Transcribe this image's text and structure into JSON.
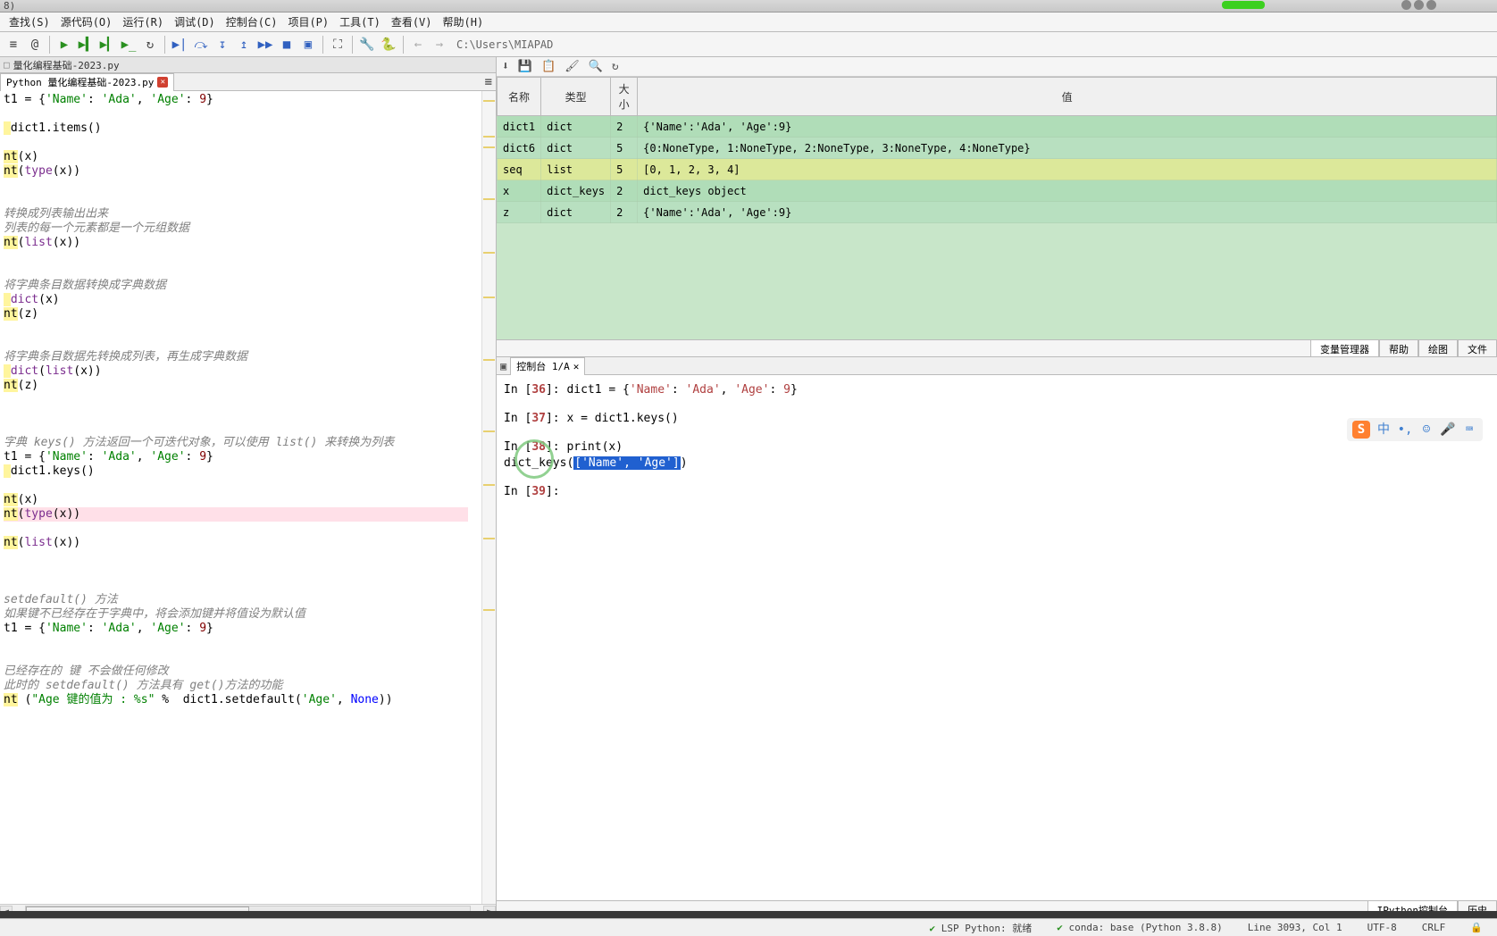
{
  "title_text": "8)",
  "menu": {
    "items": [
      "查找(S)",
      "源代码(O)",
      "运行(R)",
      "调试(D)",
      "控制台(C)",
      "项目(P)",
      "工具(T)",
      "查看(V)",
      "帮助(H)"
    ]
  },
  "toolbar": {
    "path": "C:\\Users\\MIAPAD"
  },
  "file_tab": {
    "title": "量化编程基础-2023.py"
  },
  "editor_tab": {
    "label": "Python 量化编程基础-2023.py"
  },
  "code_lines": [
    {
      "t": "assign",
      "text": "t1 = {'Name': 'Ada', 'Age': 9}"
    },
    {
      "t": "blank"
    },
    {
      "t": "items",
      "text": " dict1.items()"
    },
    {
      "t": "blank"
    },
    {
      "t": "print",
      "text": "nt(x)"
    },
    {
      "t": "printtype",
      "text": "nt(type(x))"
    },
    {
      "t": "blank"
    },
    {
      "t": "blank"
    },
    {
      "t": "comment",
      "text": "转换成列表输出出来"
    },
    {
      "t": "comment",
      "text": "列表的每一个元素都是一个元组数据"
    },
    {
      "t": "printlist",
      "text": "nt(list(x))"
    },
    {
      "t": "blank"
    },
    {
      "t": "blank"
    },
    {
      "t": "comment",
      "text": "将字典条目数据转换成字典数据"
    },
    {
      "t": "dictx",
      "text": " dict(x)"
    },
    {
      "t": "printz",
      "text": "nt(z)"
    },
    {
      "t": "blank"
    },
    {
      "t": "blank"
    },
    {
      "t": "comment",
      "text": "将字典条目数据先转换成列表，再生成字典数据"
    },
    {
      "t": "dictlistx",
      "text": " dict(list(x))"
    },
    {
      "t": "printz",
      "text": "nt(z)"
    },
    {
      "t": "blank"
    },
    {
      "t": "blank"
    },
    {
      "t": "blank"
    },
    {
      "t": "comment",
      "text": "字典 keys() 方法返回一个可迭代对象，可以使用 list() 来转换为列表"
    },
    {
      "t": "assign",
      "text": "t1 = {'Name': 'Ada', 'Age': 9}"
    },
    {
      "t": "keys",
      "text": " dict1.keys()"
    },
    {
      "t": "blank"
    },
    {
      "t": "print",
      "text": "nt(x)"
    },
    {
      "t": "printtype_run",
      "text": "nt(type(x))"
    },
    {
      "t": "blank"
    },
    {
      "t": "printlist",
      "text": "nt(list(x))"
    },
    {
      "t": "blank"
    },
    {
      "t": "blank"
    },
    {
      "t": "blank"
    },
    {
      "t": "comment",
      "text": "setdefault() 方法"
    },
    {
      "t": "comment",
      "text": "如果键不已经存在于字典中，将会添加键并将值设为默认值"
    },
    {
      "t": "assign",
      "text": "t1 = {'Name': 'Ada', 'Age': 9}"
    },
    {
      "t": "blank"
    },
    {
      "t": "blank"
    },
    {
      "t": "comment",
      "text": "已经存在的 键 不会做任何修改"
    },
    {
      "t": "comment",
      "text": "此时的 setdefault() 方法具有 get()方法的功能"
    },
    {
      "t": "printsetdef",
      "text": "nt (\"Age 键的值为 : %s\" %  dict1.setdefault('Age', None))"
    }
  ],
  "var_toolbar_icons": [
    "download",
    "save",
    "copy",
    "brush",
    "search",
    "refresh"
  ],
  "var_headers": {
    "name": "名称",
    "type": "类型",
    "size": "大小",
    "value": "值"
  },
  "variables": [
    {
      "name": "dict1",
      "type": "dict",
      "size": "2",
      "value": "{'Name':'Ada', 'Age':9}"
    },
    {
      "name": "dict6",
      "type": "dict",
      "size": "5",
      "value": "{0:NoneType, 1:NoneType, 2:NoneType, 3:NoneType, 4:NoneType}"
    },
    {
      "name": "seq",
      "type": "list",
      "size": "5",
      "value": "[0, 1, 2, 3, 4]"
    },
    {
      "name": "x",
      "type": "dict_keys",
      "size": "2",
      "value": "dict_keys object"
    },
    {
      "name": "z",
      "type": "dict",
      "size": "2",
      "value": "{'Name':'Ada', 'Age':9}"
    }
  ],
  "right_tabs": [
    "变量管理器",
    "帮助",
    "绘图",
    "文件"
  ],
  "console_tab": {
    "icon": "▣",
    "label": "控制台 1/A"
  },
  "console": {
    "in36": "In [",
    "n36": "36",
    "in36b": "]: dict1 = {",
    "s36a": "'Name'",
    "s36b": ": ",
    "s36c": "'Ada'",
    "s36d": ", ",
    "s36e": "'Age'",
    "s36f": ": ",
    "s36g": "9",
    "s36h": "}",
    "in37": "In [",
    "n37": "37",
    "in37b": "]: x = dict1.keys()",
    "in38": "In [",
    "n38": "38",
    "in38b": "]: ",
    "p38": "print",
    "p38b": "(x)",
    "out38a": "dict_keys(",
    "out38sel": "['Name', 'Age']",
    "out38b": ")",
    "in39": "In [",
    "n39": "39",
    "in39b": "]: "
  },
  "console_bottom_tabs": [
    "IPython控制台",
    "历史"
  ],
  "ime": {
    "logo": "S",
    "lang": "中"
  },
  "status": {
    "lsp": "LSP Python: 就绪",
    "conda": "conda: base (Python 3.8.8)",
    "line": "Line 3093, Col 1",
    "enc": "UTF-8",
    "eol": "CRLF"
  }
}
